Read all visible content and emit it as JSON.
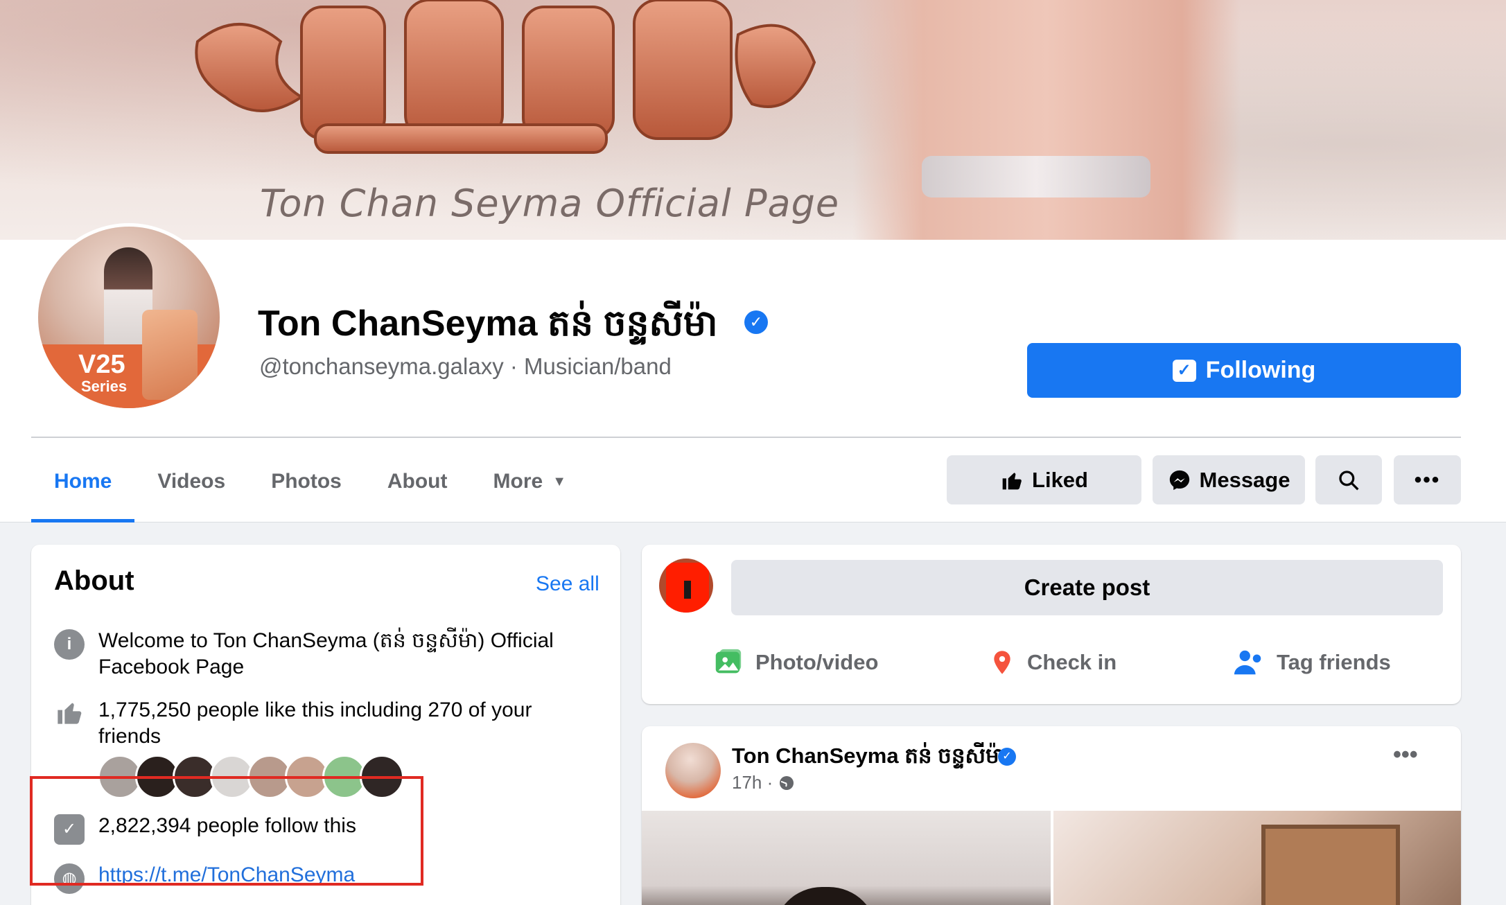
{
  "cover": {
    "tagline": "Ton Chan Seyma Official Page"
  },
  "profile": {
    "name": "Ton ChanSeyma តន់ ចន្ទសីម៉ា",
    "handle_line": "@tonchanseyma.galaxy · Musician/band",
    "avatar_text_1": "V25",
    "avatar_text_2": "Series",
    "following_label": "Following"
  },
  "tabs": [
    {
      "label": "Home",
      "active": true
    },
    {
      "label": "Videos"
    },
    {
      "label": "Photos"
    },
    {
      "label": "About"
    },
    {
      "label": "More"
    }
  ],
  "actions": {
    "liked": "Liked",
    "message": "Message"
  },
  "about": {
    "title": "About",
    "see_all": "See all",
    "welcome": "Welcome to Ton ChanSeyma (តន់ ចន្ទសីម៉ា) Official Facebook Page",
    "likes": "1,775,250 people like this including 270 of your friends",
    "followers": "2,822,394 people follow this",
    "link": "https://t.me/TonChanSeyma"
  },
  "create_post": {
    "button": "Create post",
    "photo_video": "Photo/video",
    "check_in": "Check in",
    "tag_friends": "Tag friends"
  },
  "post": {
    "author": "Ton ChanSeyma តន់ ចន្ទសីម៉ា",
    "time": "17h ·"
  },
  "colors": {
    "accent": "#1877f2",
    "highlight_box": "#e02a22"
  }
}
